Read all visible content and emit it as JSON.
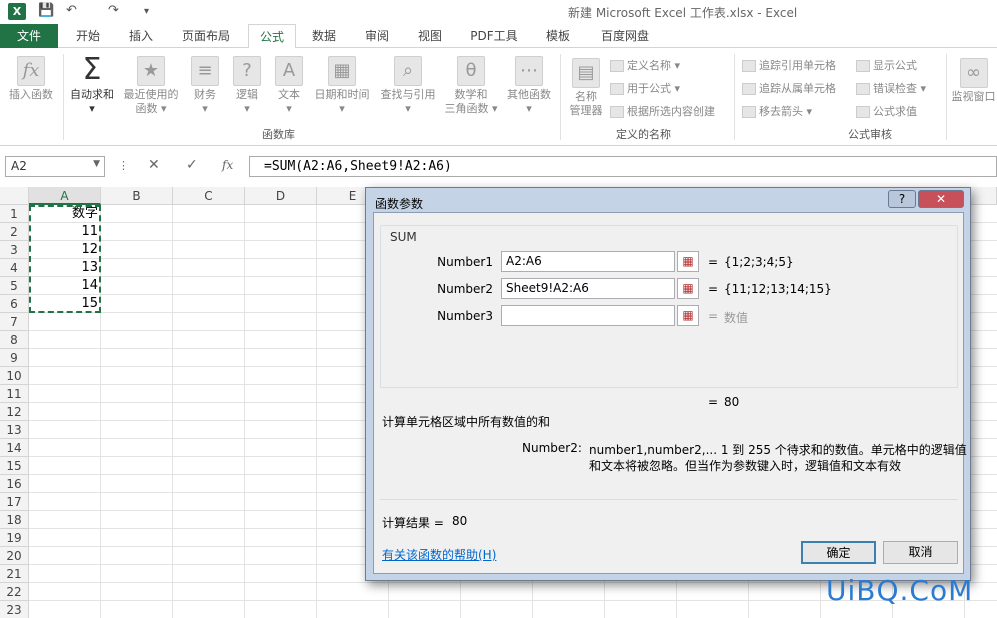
{
  "window": {
    "title": "新建 Microsoft Excel 工作表.xlsx - Excel",
    "app_icon": "X"
  },
  "tabs": [
    "文件",
    "开始",
    "插入",
    "页面布局",
    "公式",
    "数据",
    "审阅",
    "视图",
    "PDF工具",
    "模板",
    "百度网盘"
  ],
  "ribbon": {
    "insert_function": "插入函数",
    "autosum": "自动求和",
    "recent": [
      "最近使用的",
      "函数"
    ],
    "finance": "财务",
    "logic": "逻辑",
    "text": "文本",
    "datetime": "日期和时间",
    "lookup": "查找与引用",
    "math": [
      "数学和",
      "三角函数"
    ],
    "other": "其他函数",
    "group_library": "函数库",
    "name_mgr": [
      "名称",
      "管理器"
    ],
    "define_name": "定义名称",
    "use_in_formula": "用于公式",
    "create_from_sel": "根据所选内容创建",
    "group_names": "定义的名称",
    "trace_prec": "追踪引用单元格",
    "trace_dep": "追踪从属单元格",
    "remove_arrows": "移去箭头",
    "show_formulas": "显示公式",
    "error_check": "错误检查",
    "eval_formula": "公式求值",
    "group_audit": "公式审核",
    "watch": "监视窗口",
    "fx_icon": "fx",
    "sigma_icon": "Σ"
  },
  "formula_bar": {
    "name_box": "A2",
    "formula": "=SUM(A2:A6,Sheet9!A2:A6)",
    "fx": "fx"
  },
  "columns": [
    "A",
    "B",
    "C",
    "D",
    "E"
  ],
  "rows": [
    "1",
    "2",
    "3",
    "4",
    "5",
    "6",
    "7",
    "8",
    "9",
    "10",
    "11",
    "12",
    "13",
    "14",
    "15",
    "16",
    "17",
    "18",
    "19",
    "20",
    "21",
    "22",
    "23"
  ],
  "cells": {
    "A1": "数字",
    "A2": "11",
    "A3": "12",
    "A4": "13",
    "A5": "14",
    "A6": "15"
  },
  "dialog": {
    "title": "函数参数",
    "help_btn": "?",
    "close_btn": "✕",
    "function": "SUM",
    "args": [
      {
        "label": "Number1",
        "value": "A2:A6",
        "result": "{1;2;3;4;5}"
      },
      {
        "label": "Number2",
        "value": "Sheet9!A2:A6",
        "result": "{11;12;13;14;15}"
      },
      {
        "label": "Number3",
        "value": "",
        "result": "数值"
      }
    ],
    "eq": "=",
    "total": "80",
    "description": "计算单元格区域中所有数值的和",
    "param_label": "Number2:",
    "param_desc1": "number1,number2,...  1 到 255 个待求和的数值。单元格中的逻辑值",
    "param_desc2": "和文本将被忽略。但当作为参数键入时，逻辑值和文本有效",
    "result_label": "计算结果 =",
    "result_value": "80",
    "help_link": "有关该函数的帮助(H)",
    "ok": "确定",
    "cancel": "取消"
  },
  "watermark": "UiBQ.CoM"
}
